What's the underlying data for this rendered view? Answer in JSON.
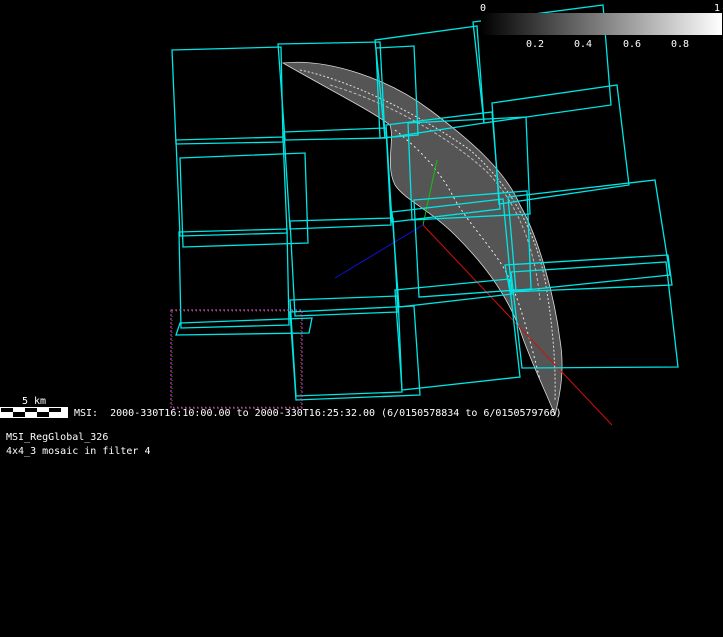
{
  "colorbar": {
    "min_label": "0",
    "max_label": "1",
    "ticks": [
      "0.2",
      "0.4",
      "0.6",
      "0.8"
    ]
  },
  "scale_bar": {
    "label": "5 km"
  },
  "info": {
    "time_range": "MSI:  2000-330T16:10:00.00 to 2000-330T16:25:32.00 (6/0150578834 to 6/0150579766)",
    "dataset": "MSI_RegGlobal_326",
    "description": "4x4_3 mosaic in filter 4"
  },
  "colors": {
    "footprint": "#00e5e5",
    "selected_footprint": "#e040e0",
    "axis_x": "#d01010",
    "axis_y": "#10c010",
    "axis_z": "#1010e0",
    "asteroid": "#c8c8c8"
  }
}
